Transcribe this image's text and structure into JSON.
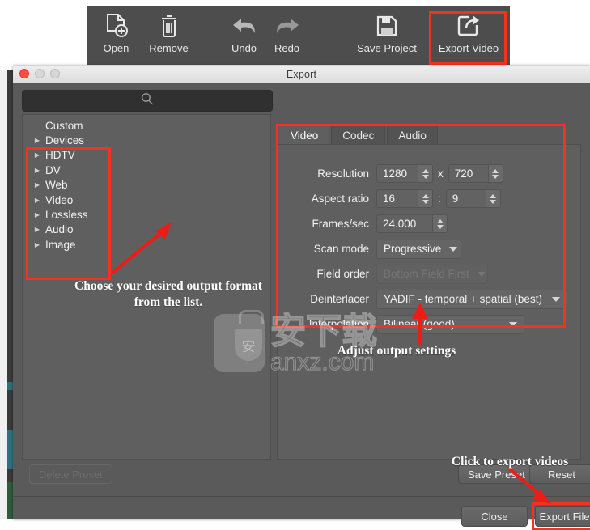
{
  "toolbar": {
    "items": [
      {
        "label": "Open",
        "icon": "file-add-icon"
      },
      {
        "label": "Remove",
        "icon": "trash-icon"
      },
      {
        "label": "Undo",
        "icon": "undo-arrow-icon"
      },
      {
        "label": "Redo",
        "icon": "redo-arrow-icon"
      },
      {
        "label": "Save Project",
        "icon": "floppy-disk-icon"
      },
      {
        "label": "Export Video",
        "icon": "export-share-icon"
      }
    ]
  },
  "dialog": {
    "title": "Export",
    "search": {
      "placeholder": "",
      "value": "",
      "icon": "search-icon"
    },
    "presets": [
      {
        "label": "Custom",
        "expandable": false
      },
      {
        "label": "Devices",
        "expandable": true
      },
      {
        "label": "HDTV",
        "expandable": true
      },
      {
        "label": "DV",
        "expandable": true
      },
      {
        "label": "Web",
        "expandable": true
      },
      {
        "label": "Video",
        "expandable": true
      },
      {
        "label": "Lossless",
        "expandable": true
      },
      {
        "label": "Audio",
        "expandable": true
      },
      {
        "label": "Image",
        "expandable": true
      }
    ],
    "tabs": [
      {
        "label": "Video",
        "active": true
      },
      {
        "label": "Codec",
        "active": false
      },
      {
        "label": "Audio",
        "active": false
      }
    ],
    "video_settings": {
      "resolution": {
        "label": "Resolution",
        "width": "1280",
        "separator": "x",
        "height": "720"
      },
      "aspect_ratio": {
        "label": "Aspect ratio",
        "num": "16",
        "separator": ":",
        "den": "9"
      },
      "frames_sec": {
        "label": "Frames/sec",
        "value": "24.000"
      },
      "scan_mode": {
        "label": "Scan mode",
        "value": "Progressive"
      },
      "field_order": {
        "label": "Field order",
        "value": "Bottom Field First",
        "disabled": true
      },
      "deinterlacer": {
        "label": "Deinterlacer",
        "value": "YADIF - temporal + spatial (best)"
      },
      "interpolation": {
        "label": "Interpolation",
        "value": "Bilinear (good)"
      }
    },
    "buttons": {
      "delete_preset": "Delete Preset",
      "save_preset": "Save Preset",
      "reset": "Reset",
      "close": "Close",
      "export_file": "Export File"
    }
  },
  "annotations": [
    {
      "id": "choose-format",
      "text": "Choose your desired output format from the list."
    },
    {
      "id": "adjust-settings",
      "text": "Adjust output settings"
    },
    {
      "id": "click-export",
      "text": "Click to export videos"
    }
  ],
  "watermark": {
    "cn": "安下载",
    "en": "anxz.com",
    "badge_glyph": "安"
  },
  "colors": {
    "highlight": "#f5321e",
    "dialog_bg": "#5a5a5a",
    "panel_bg": "#5f5f5f",
    "toolbar_bg": "#4d4d4d",
    "titlebar_bg": "#e6e6e6",
    "text": "#f2f2f2"
  }
}
